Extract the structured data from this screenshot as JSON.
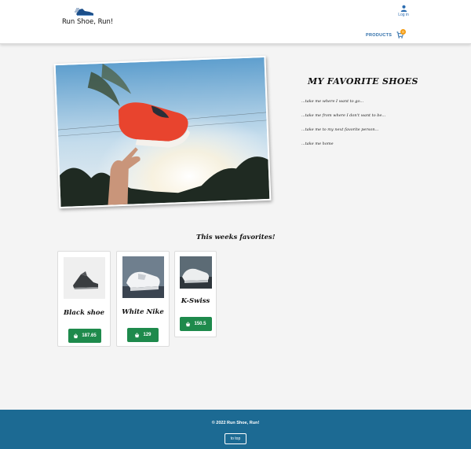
{
  "header": {
    "brand_name": "Run Shoe, Run!",
    "login_label": "Log in",
    "nav_products": "PRODUCTS",
    "cart_count": "0"
  },
  "hero": {
    "title": "MY FAVORITE SHOES",
    "lines": [
      "...take me where I want to go...",
      "...take me from where I don't want to be...",
      "...take me to my next favorite person...",
      "...take me home"
    ]
  },
  "favorites": {
    "title": "This weeks favorites!",
    "products": [
      {
        "name": "Black shoe",
        "price": "187.65"
      },
      {
        "name": "White Nike",
        "price": "129"
      },
      {
        "name": "K-Swiss",
        "price": "150.5"
      }
    ]
  },
  "footer": {
    "copyright": "© 2022 Run Shoe, Run!",
    "to_top": "to top"
  },
  "colors": {
    "accent": "#1c6a93",
    "buy_button": "#1e8a4c",
    "nav_link": "#2b6ca8",
    "cart_badge": "#f39c12"
  },
  "icons": [
    "running-shoe-logo-icon",
    "user-icon",
    "cart-icon",
    "basket-icon"
  ]
}
